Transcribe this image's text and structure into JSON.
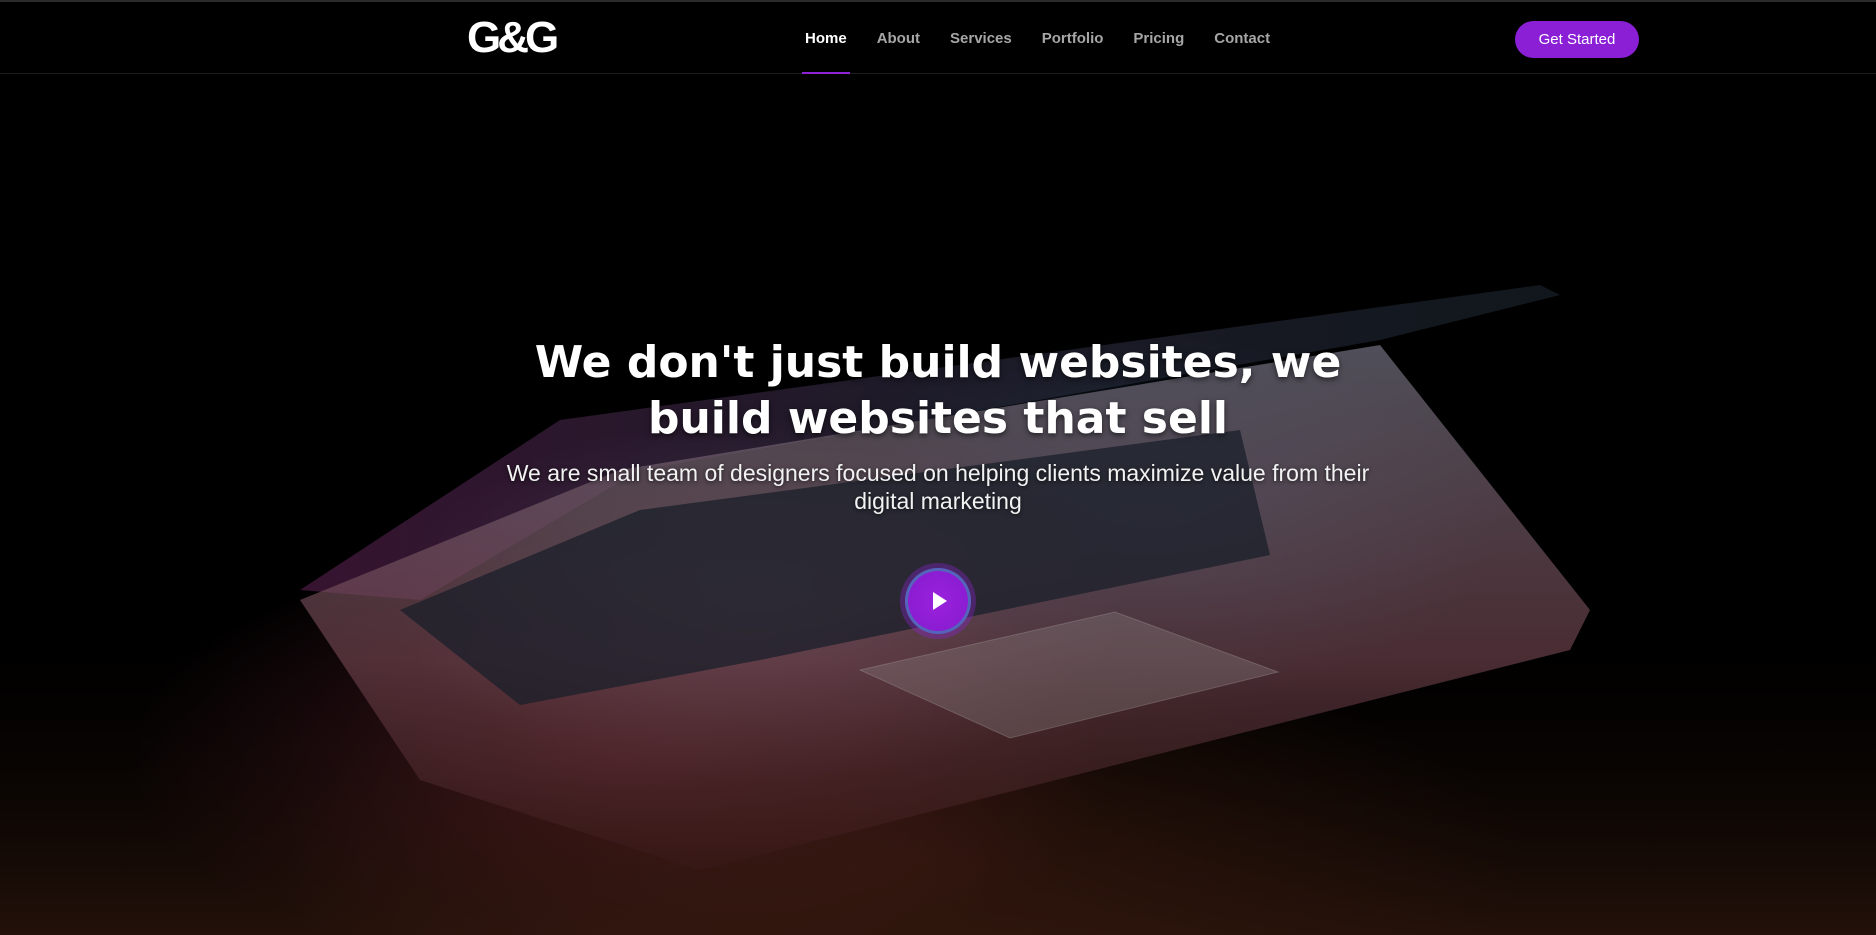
{
  "header": {
    "logo_text": "G&G",
    "nav": [
      {
        "label": "Home",
        "active": true
      },
      {
        "label": "About",
        "active": false
      },
      {
        "label": "Services",
        "active": false
      },
      {
        "label": "Portfolio",
        "active": false
      },
      {
        "label": "Pricing",
        "active": false
      },
      {
        "label": "Contact",
        "active": false
      }
    ],
    "cta_label": "Get Started"
  },
  "hero": {
    "title": "We don't just build websites, we build websites that sell",
    "subtitle": "We are small team of designers focused on helping clients maximize value from their digital marketing",
    "play_icon": "play-icon",
    "background_image": "laptop-photo"
  },
  "colors": {
    "accent": "#8a1fd6",
    "background": "#000000",
    "nav_text": "#a6a6a6",
    "nav_text_active": "#ffffff"
  }
}
